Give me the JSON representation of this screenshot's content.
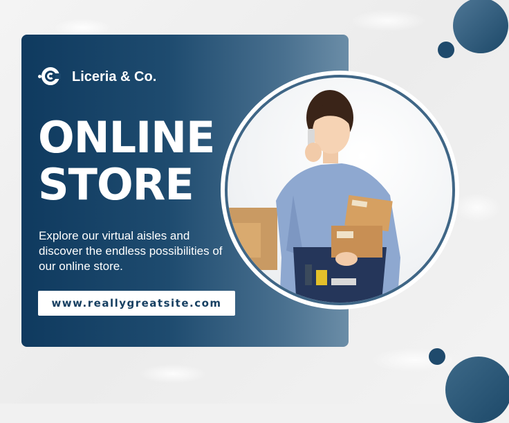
{
  "brand": {
    "name": "Liceria & Co."
  },
  "headline": {
    "line1": "ONLINE",
    "line2": "STORE"
  },
  "description": "Explore our virtual aisles and discover the endless possibilities of our online store.",
  "cta": {
    "url_label": "www.reallygreatsite.com"
  },
  "colors": {
    "navy": "#0f3a5f",
    "steel": "#6b8da7",
    "accent": "#1f4a6c",
    "background": "#f1f1f1"
  }
}
